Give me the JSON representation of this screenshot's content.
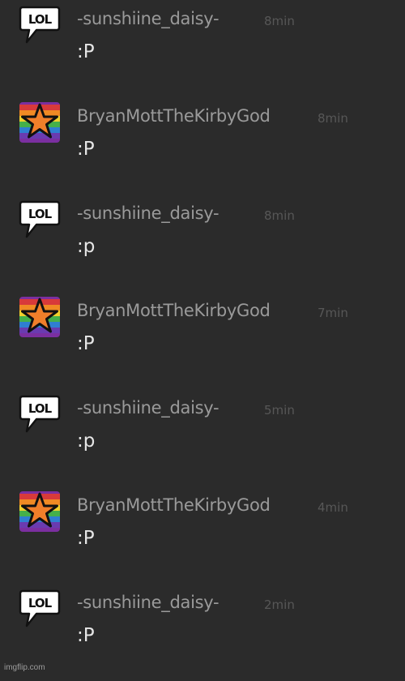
{
  "comments": [
    {
      "user": "-sunshiine_daisy-",
      "time": "8min",
      "text": ":P",
      "avatar": "lol-bubble-icon"
    },
    {
      "user": "BryanMottTheKirbyGod",
      "time": "8min",
      "text": ":P",
      "avatar": "rainbow-star-icon"
    },
    {
      "user": "-sunshiine_daisy-",
      "time": "8min",
      "text": ":p",
      "avatar": "lol-bubble-icon"
    },
    {
      "user": "BryanMottTheKirbyGod",
      "time": "7min",
      "text": ":P",
      "avatar": "rainbow-star-icon"
    },
    {
      "user": "-sunshiine_daisy-",
      "time": "5min",
      "text": ":p",
      "avatar": "lol-bubble-icon"
    },
    {
      "user": "BryanMottTheKirbyGod",
      "time": "4min",
      "text": ":P",
      "avatar": "rainbow-star-icon"
    },
    {
      "user": "-sunshiine_daisy-",
      "time": "2min",
      "text": ":P",
      "avatar": "lol-bubble-icon"
    }
  ],
  "avatar_lol_text": "LOL",
  "watermark": "imgflip.com",
  "colors": {
    "background": "#2b2b2b",
    "username": "#9a9a9a",
    "timestamp": "#575757",
    "message": "#e6e6e6"
  }
}
